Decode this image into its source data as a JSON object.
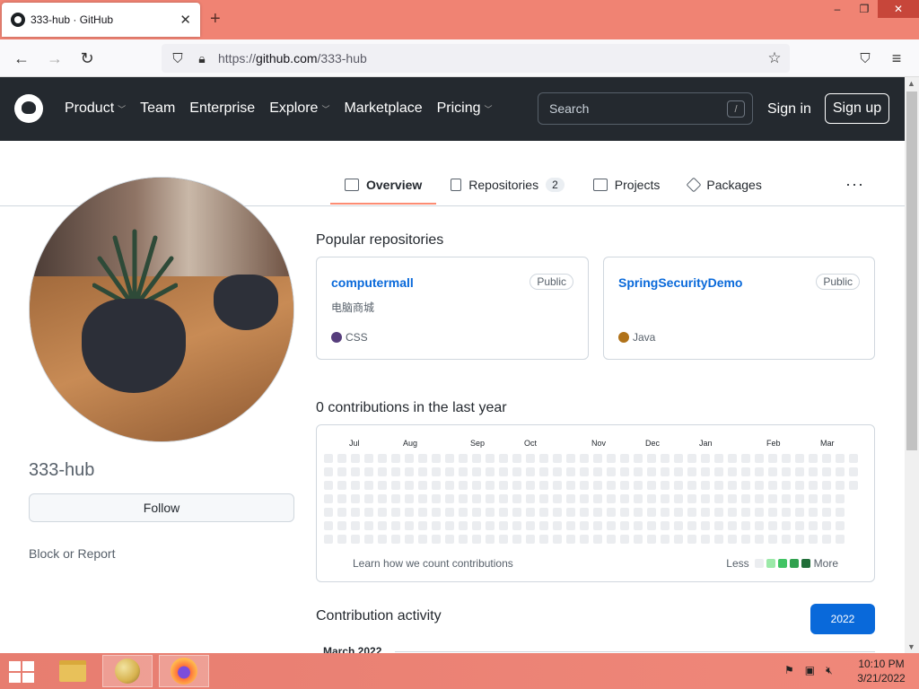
{
  "browser": {
    "tab_title": "333-hub · GitHub",
    "tab_close": "✕",
    "new_tab": "+",
    "url_prefix": "https://",
    "url_domain": "github.com",
    "url_path": "/333-hub",
    "window_controls": [
      "–",
      "❐",
      "✕"
    ]
  },
  "gh_header": {
    "nav": [
      {
        "label": "Product",
        "dropdown": true
      },
      {
        "label": "Team",
        "dropdown": false
      },
      {
        "label": "Enterprise",
        "dropdown": false
      },
      {
        "label": "Explore",
        "dropdown": true
      },
      {
        "label": "Marketplace",
        "dropdown": false
      },
      {
        "label": "Pricing",
        "dropdown": true
      }
    ],
    "search_placeholder": "Search",
    "search_key": "/",
    "sign_in": "Sign in",
    "sign_up": "Sign up"
  },
  "profile_tabs": {
    "overview": "Overview",
    "repositories": "Repositories",
    "repositories_count": "2",
    "projects": "Projects",
    "packages": "Packages",
    "more": "···"
  },
  "profile": {
    "username": "333-hub",
    "follow": "Follow",
    "block": "Block or Report"
  },
  "popular": {
    "title": "Popular repositories",
    "repos": [
      {
        "name": "computermall",
        "badge": "Public",
        "desc": "电脑商城",
        "lang": "CSS",
        "lang_color": "#563d7c"
      },
      {
        "name": "SpringSecurityDemo",
        "badge": "Public",
        "desc": "",
        "lang": "Java",
        "lang_color": "#b07219"
      }
    ]
  },
  "contributions": {
    "title": "0 contributions in the last year",
    "months": [
      "Jul",
      "Aug",
      "Sep",
      "Oct",
      "Nov",
      "Dec",
      "Jan",
      "Feb",
      "Mar"
    ],
    "learn": "Learn how we count contributions",
    "less": "Less",
    "more": "More",
    "legend_colors": [
      "#ebedf0",
      "#9be9a8",
      "#40c463",
      "#30a14e",
      "#216e39"
    ]
  },
  "activity": {
    "title": "Contribution activity",
    "year": "2022",
    "month": "March 2022"
  },
  "taskbar": {
    "time": "10:10 PM",
    "date": "3/21/2022"
  }
}
